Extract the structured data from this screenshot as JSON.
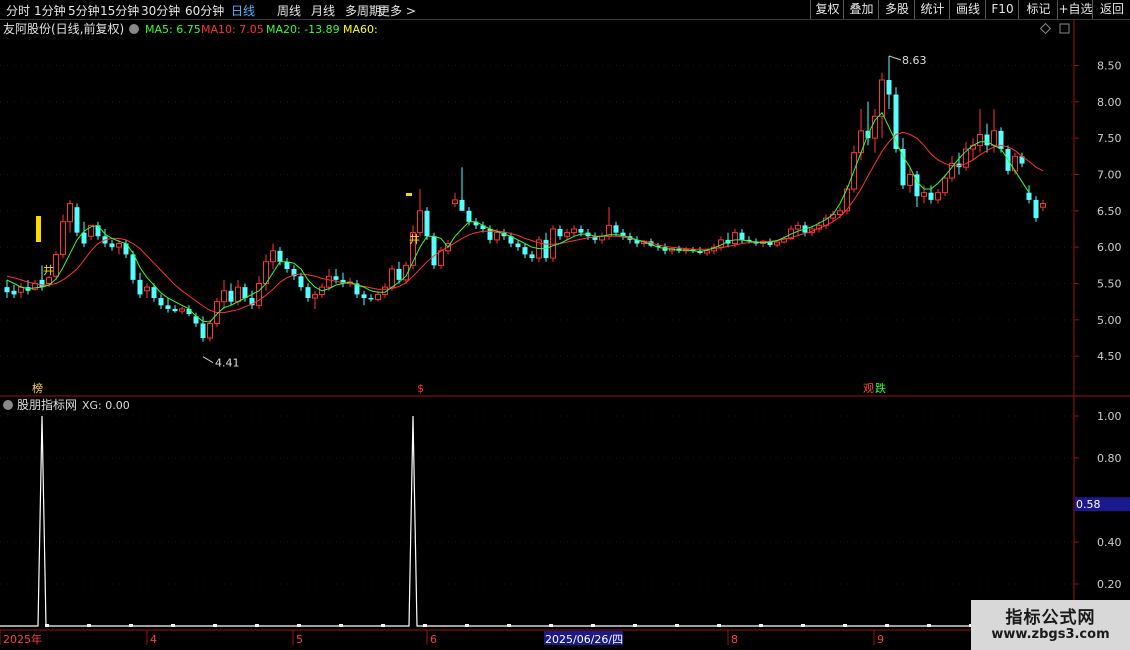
{
  "toolbar": {
    "periods": [
      "分时",
      "1分钟",
      "5分钟",
      "15分钟",
      "30分钟",
      "60分钟",
      "日线",
      "周线",
      "月线",
      "多周期",
      "更多 >"
    ],
    "active_period": "日线",
    "buttons": [
      "复权",
      "叠加",
      "多股",
      "统计",
      "画线",
      "F10",
      "标记",
      "+自选",
      "返回"
    ]
  },
  "main_header": {
    "stock_name": "友阿股份(日线,前复权)",
    "ma5": "MA5: 6.75",
    "ma10": "MA10: 7.05",
    "ma20": "MA20: -13.89",
    "ma60": "MA60:"
  },
  "indicator_header": {
    "name": "股朋指标网",
    "xg": "XG: 0.00"
  },
  "colors": {
    "up": "#ff3232",
    "down": "#54ffff",
    "ma5": "#32ff32",
    "ma10": "#ff3232",
    "ma20": "#32ff32",
    "ma60": "#ffff00",
    "axis": "#a01212",
    "signal": "#ffffff",
    "active_tab": "#4fb3ff"
  },
  "main_axis": {
    "ticks": [
      "8.50",
      "8.00",
      "7.50",
      "7.00",
      "6.50",
      "6.00",
      "5.50",
      "5.00",
      "4.50"
    ],
    "ylim": [
      4.2,
      8.85
    ]
  },
  "indicator_axis": {
    "ticks": [
      "1.00",
      "0.80",
      "0.40",
      "0.20"
    ],
    "current_value": "0.58",
    "ylim": [
      0,
      1
    ]
  },
  "annotations": {
    "high": "8.63",
    "low": "4.41",
    "markers": [
      {
        "text": "榜",
        "color": "#ffd24a"
      },
      {
        "text": "$",
        "color": "#ff3030"
      },
      {
        "text": "观",
        "color": "#ff4040"
      },
      {
        "text": "跌",
        "color": "#32ff32"
      }
    ]
  },
  "date_axis": {
    "labels": [
      "2025年",
      "4",
      "5",
      "6",
      "2025/06/26/四",
      "8",
      "9"
    ]
  },
  "watermark": {
    "line1": "指标公式网",
    "line2": "www.zbgs3.com"
  },
  "chart_data": {
    "type": "candlestick",
    "title": "友阿股份(日线,前复权)",
    "ylim": [
      4.2,
      8.85
    ],
    "candles": [
      [
        5.45,
        5.55,
        5.3,
        5.38
      ],
      [
        5.4,
        5.48,
        5.3,
        5.35
      ],
      [
        5.38,
        5.5,
        5.3,
        5.45
      ],
      [
        5.45,
        5.55,
        5.35,
        5.4
      ],
      [
        5.42,
        5.55,
        5.4,
        5.5
      ],
      [
        5.55,
        5.75,
        5.4,
        5.45
      ],
      [
        5.5,
        5.6,
        5.45,
        5.58
      ],
      [
        5.6,
        5.95,
        5.55,
        5.9
      ],
      [
        5.9,
        6.45,
        5.85,
        6.35
      ],
      [
        6.35,
        6.65,
        6.2,
        6.6
      ],
      [
        6.55,
        6.6,
        6.15,
        6.2
      ],
      [
        6.2,
        6.35,
        6.0,
        6.05
      ],
      [
        6.15,
        6.3,
        6.1,
        6.3
      ],
      [
        6.3,
        6.35,
        6.1,
        6.15
      ],
      [
        6.15,
        6.25,
        6.0,
        6.05
      ],
      [
        6.05,
        6.1,
        5.95,
        6.0
      ],
      [
        6.0,
        6.1,
        5.9,
        6.05
      ],
      [
        6.05,
        6.1,
        5.85,
        5.9
      ],
      [
        5.9,
        5.95,
        5.5,
        5.55
      ],
      [
        5.55,
        5.65,
        5.3,
        5.35
      ],
      [
        5.4,
        5.5,
        5.3,
        5.45
      ],
      [
        5.45,
        5.5,
        5.25,
        5.3
      ],
      [
        5.3,
        5.35,
        5.15,
        5.2
      ],
      [
        5.2,
        5.3,
        5.1,
        5.15
      ],
      [
        5.15,
        5.2,
        5.1,
        5.12
      ],
      [
        5.12,
        5.18,
        5.08,
        5.15
      ],
      [
        5.15,
        5.2,
        5.05,
        5.08
      ],
      [
        5.05,
        5.1,
        4.9,
        4.95
      ],
      [
        4.95,
        5.05,
        4.7,
        4.75
      ],
      [
        4.75,
        5.0,
        4.7,
        4.95
      ],
      [
        4.95,
        5.3,
        4.9,
        5.25
      ],
      [
        5.25,
        5.55,
        5.15,
        5.4
      ],
      [
        5.4,
        5.5,
        5.2,
        5.25
      ],
      [
        5.25,
        5.55,
        5.2,
        5.45
      ],
      [
        5.45,
        5.5,
        5.25,
        5.3
      ],
      [
        5.3,
        5.4,
        5.15,
        5.2
      ],
      [
        5.2,
        5.6,
        5.15,
        5.5
      ],
      [
        5.5,
        5.9,
        5.4,
        5.8
      ],
      [
        5.8,
        6.05,
        5.7,
        5.95
      ],
      [
        5.95,
        6.0,
        5.75,
        5.8
      ],
      [
        5.8,
        5.85,
        5.65,
        5.7
      ],
      [
        5.7,
        5.75,
        5.55,
        5.6
      ],
      [
        5.6,
        5.65,
        5.4,
        5.45
      ],
      [
        5.45,
        5.5,
        5.25,
        5.3
      ],
      [
        5.3,
        5.4,
        5.15,
        5.35
      ],
      [
        5.35,
        5.5,
        5.3,
        5.45
      ],
      [
        5.45,
        5.7,
        5.4,
        5.6
      ],
      [
        5.6,
        5.7,
        5.5,
        5.55
      ],
      [
        5.55,
        5.65,
        5.45,
        5.5
      ],
      [
        5.5,
        5.58,
        5.45,
        5.52
      ],
      [
        5.5,
        5.55,
        5.3,
        5.35
      ],
      [
        5.35,
        5.4,
        5.2,
        5.3
      ],
      [
        5.3,
        5.35,
        5.25,
        5.28
      ],
      [
        5.28,
        5.4,
        5.25,
        5.35
      ],
      [
        5.35,
        5.5,
        5.3,
        5.45
      ],
      [
        5.45,
        5.75,
        5.4,
        5.7
      ],
      [
        5.7,
        5.8,
        5.5,
        5.55
      ],
      [
        5.55,
        5.8,
        5.5,
        5.75
      ],
      [
        5.75,
        6.3,
        5.7,
        6.2
      ],
      [
        6.2,
        6.8,
        6.15,
        6.5
      ],
      [
        6.5,
        6.55,
        6.1,
        6.15
      ],
      [
        6.15,
        6.2,
        5.7,
        5.75
      ],
      [
        5.75,
        6.0,
        5.7,
        5.95
      ],
      [
        5.95,
        6.1,
        5.9,
        6.05
      ],
      [
        6.6,
        6.75,
        6.55,
        6.65
      ],
      [
        6.65,
        7.1,
        6.55,
        6.5
      ],
      [
        6.5,
        6.55,
        6.3,
        6.35
      ],
      [
        6.35,
        6.4,
        6.25,
        6.3
      ],
      [
        6.3,
        6.35,
        6.2,
        6.25
      ],
      [
        6.25,
        6.3,
        6.05,
        6.1
      ],
      [
        6.1,
        6.25,
        6.05,
        6.2
      ],
      [
        6.2,
        6.25,
        6.1,
        6.15
      ],
      [
        6.15,
        6.2,
        6.0,
        6.05
      ],
      [
        6.05,
        6.1,
        5.95,
        6.0
      ],
      [
        6.0,
        6.05,
        5.85,
        5.9
      ],
      [
        5.9,
        5.95,
        5.8,
        5.85
      ],
      [
        5.85,
        6.15,
        5.8,
        6.1
      ],
      [
        6.1,
        6.2,
        5.8,
        5.85
      ],
      [
        5.85,
        6.3,
        5.8,
        6.25
      ],
      [
        6.25,
        6.3,
        6.1,
        6.15
      ],
      [
        6.15,
        6.25,
        6.1,
        6.2
      ],
      [
        6.2,
        6.3,
        6.15,
        6.25
      ],
      [
        6.25,
        6.3,
        6.15,
        6.2
      ],
      [
        6.2,
        6.25,
        6.1,
        6.15
      ],
      [
        6.15,
        6.2,
        6.05,
        6.1
      ],
      [
        6.1,
        6.2,
        6.05,
        6.15
      ],
      [
        6.15,
        6.55,
        6.1,
        6.3
      ],
      [
        6.3,
        6.35,
        6.15,
        6.2
      ],
      [
        6.2,
        6.25,
        6.1,
        6.15
      ],
      [
        6.15,
        6.2,
        6.05,
        6.1
      ],
      [
        6.1,
        6.15,
        6.0,
        6.05
      ],
      [
        6.05,
        6.1,
        6.0,
        6.08
      ],
      [
        6.08,
        6.12,
        6.0,
        6.02
      ],
      [
        6.02,
        6.06,
        5.95,
        6.0
      ],
      [
        6.0,
        6.05,
        5.9,
        5.95
      ],
      [
        5.95,
        6.0,
        5.9,
        5.98
      ],
      [
        5.98,
        6.02,
        5.92,
        5.95
      ],
      [
        5.95,
        6.0,
        5.9,
        5.97
      ],
      [
        5.97,
        6.0,
        5.92,
        5.95
      ],
      [
        5.95,
        6.0,
        5.9,
        5.92
      ],
      [
        5.92,
        5.98,
        5.88,
        5.95
      ],
      [
        5.95,
        6.05,
        5.9,
        6.0
      ],
      [
        6.0,
        6.15,
        5.95,
        6.1
      ],
      [
        6.1,
        6.2,
        6.0,
        6.05
      ],
      [
        6.05,
        6.25,
        6.0,
        6.2
      ],
      [
        6.2,
        6.25,
        6.05,
        6.1
      ],
      [
        6.1,
        6.15,
        6.05,
        6.08
      ],
      [
        6.08,
        6.12,
        6.02,
        6.05
      ],
      [
        6.05,
        6.1,
        6.0,
        6.08
      ],
      [
        6.08,
        6.12,
        6.0,
        6.03
      ],
      [
        6.03,
        6.1,
        6.0,
        6.07
      ],
      [
        6.07,
        6.15,
        6.05,
        6.12
      ],
      [
        6.12,
        6.3,
        6.1,
        6.25
      ],
      [
        6.25,
        6.35,
        6.15,
        6.3
      ],
      [
        6.3,
        6.35,
        6.15,
        6.2
      ],
      [
        6.2,
        6.3,
        6.15,
        6.25
      ],
      [
        6.25,
        6.35,
        6.2,
        6.3
      ],
      [
        6.3,
        6.45,
        6.25,
        6.4
      ],
      [
        6.4,
        6.5,
        6.35,
        6.45
      ],
      [
        6.45,
        6.55,
        6.4,
        6.5
      ],
      [
        6.5,
        6.85,
        6.45,
        6.8
      ],
      [
        6.8,
        7.4,
        6.75,
        7.3
      ],
      [
        7.3,
        7.9,
        7.2,
        7.6
      ],
      [
        7.6,
        8.0,
        7.4,
        7.5
      ],
      [
        7.5,
        7.9,
        7.3,
        7.8
      ],
      [
        7.8,
        8.4,
        7.5,
        8.3
      ],
      [
        8.3,
        8.63,
        7.9,
        8.1
      ],
      [
        8.1,
        8.2,
        7.3,
        7.35
      ],
      [
        7.35,
        7.5,
        6.8,
        6.85
      ],
      [
        6.85,
        7.1,
        6.75,
        7.0
      ],
      [
        7.0,
        7.05,
        6.55,
        6.7
      ],
      [
        6.7,
        6.85,
        6.6,
        6.75
      ],
      [
        6.75,
        6.85,
        6.6,
        6.65
      ],
      [
        6.65,
        6.8,
        6.6,
        6.75
      ],
      [
        6.75,
        7.0,
        6.7,
        6.95
      ],
      [
        6.95,
        7.25,
        6.9,
        7.15
      ],
      [
        7.15,
        7.3,
        7.0,
        7.1
      ],
      [
        7.1,
        7.45,
        7.05,
        7.35
      ],
      [
        7.35,
        7.5,
        7.2,
        7.4
      ],
      [
        7.4,
        7.9,
        7.3,
        7.55
      ],
      [
        7.55,
        7.7,
        7.3,
        7.4
      ],
      [
        7.4,
        7.9,
        7.3,
        7.6
      ],
      [
        7.6,
        7.65,
        7.3,
        7.35
      ],
      [
        7.35,
        7.4,
        7.0,
        7.05
      ],
      [
        7.05,
        7.3,
        7.0,
        7.25
      ],
      [
        7.25,
        7.3,
        7.1,
        7.15
      ],
      [
        6.75,
        6.85,
        6.6,
        6.65
      ],
      [
        6.65,
        6.7,
        6.35,
        6.4
      ],
      [
        6.55,
        6.65,
        6.5,
        6.6
      ]
    ],
    "ma5": [
      5.55,
      5.5,
      5.45,
      5.43,
      5.44,
      5.45,
      5.48,
      5.56,
      5.72,
      5.91,
      6.1,
      6.22,
      6.28,
      6.3,
      6.18,
      6.12,
      6.08,
      6.05,
      5.92,
      5.72,
      5.58,
      5.48,
      5.37,
      5.3,
      5.25,
      5.2,
      5.15,
      5.05,
      4.98,
      4.97,
      5.08,
      5.17,
      5.2,
      5.25,
      5.3,
      5.35,
      5.4,
      5.5,
      5.65,
      5.8,
      5.8,
      5.78,
      5.7,
      5.55,
      5.45,
      5.4,
      5.43,
      5.48,
      5.5,
      5.52,
      5.48,
      5.45,
      5.4,
      5.38,
      5.38,
      5.45,
      5.52,
      5.6,
      5.8,
      6.0,
      6.15,
      6.15,
      6.12,
      6.0,
      6.15,
      6.25,
      6.35,
      6.35,
      6.3,
      6.25,
      6.22,
      6.18,
      6.15,
      6.1,
      6.05,
      6.0,
      5.98,
      5.98,
      6.02,
      6.05,
      6.1,
      6.15,
      6.18,
      6.18,
      6.15,
      6.15,
      6.17,
      6.17,
      6.16,
      6.13,
      6.1,
      6.07,
      6.04,
      6.0,
      5.98,
      5.97,
      5.96,
      5.96,
      5.95,
      5.94,
      5.96,
      5.99,
      6.03,
      6.08,
      6.1,
      6.1,
      6.08,
      6.07,
      6.06,
      6.07,
      6.09,
      6.13,
      6.18,
      6.22,
      6.25,
      6.28,
      6.33,
      6.38,
      6.45,
      6.6,
      6.8,
      7.05,
      7.3,
      7.55,
      7.75,
      7.85,
      7.65,
      7.45,
      7.25,
      7.1,
      6.9,
      6.8,
      6.8,
      6.88,
      6.98,
      7.1,
      7.22,
      7.32,
      7.4,
      7.45,
      7.45,
      7.4,
      7.35,
      7.2,
      7.05,
      6.9,
      6.75
    ],
    "ma10": [
      5.6,
      5.58,
      5.55,
      5.52,
      5.5,
      5.48,
      5.48,
      5.5,
      5.55,
      5.62,
      5.7,
      5.82,
      5.95,
      6.05,
      6.1,
      6.12,
      6.12,
      6.1,
      6.05,
      5.98,
      5.88,
      5.78,
      5.68,
      5.58,
      5.48,
      5.4,
      5.33,
      5.26,
      5.19,
      5.13,
      5.1,
      5.1,
      5.12,
      5.14,
      5.18,
      5.22,
      5.27,
      5.34,
      5.42,
      5.52,
      5.58,
      5.62,
      5.63,
      5.62,
      5.6,
      5.57,
      5.55,
      5.53,
      5.51,
      5.5,
      5.48,
      5.46,
      5.44,
      5.42,
      5.42,
      5.43,
      5.46,
      5.51,
      5.6,
      5.7,
      5.8,
      5.88,
      5.95,
      6.0,
      6.06,
      6.12,
      6.17,
      6.2,
      6.22,
      6.22,
      6.22,
      6.21,
      6.19,
      6.16,
      6.12,
      6.09,
      6.06,
      6.04,
      6.04,
      6.05,
      6.07,
      6.09,
      6.11,
      6.13,
      6.14,
      6.15,
      6.15,
      6.15,
      6.14,
      6.12,
      6.1,
      6.08,
      6.06,
      6.03,
      6.01,
      6.0,
      5.99,
      5.98,
      5.97,
      5.97,
      5.97,
      5.98,
      5.99,
      6.01,
      6.03,
      6.05,
      6.06,
      6.07,
      6.07,
      6.08,
      6.09,
      6.11,
      6.13,
      6.16,
      6.19,
      6.22,
      6.26,
      6.3,
      6.35,
      6.42,
      6.52,
      6.65,
      6.8,
      6.98,
      7.15,
      7.32,
      7.45,
      7.55,
      7.58,
      7.55,
      7.5,
      7.4,
      7.28,
      7.2,
      7.15,
      7.12,
      7.12,
      7.15,
      7.2,
      7.27,
      7.33,
      7.38,
      7.4,
      7.38,
      7.33,
      7.25,
      7.18,
      7.1,
      7.05
    ]
  }
}
